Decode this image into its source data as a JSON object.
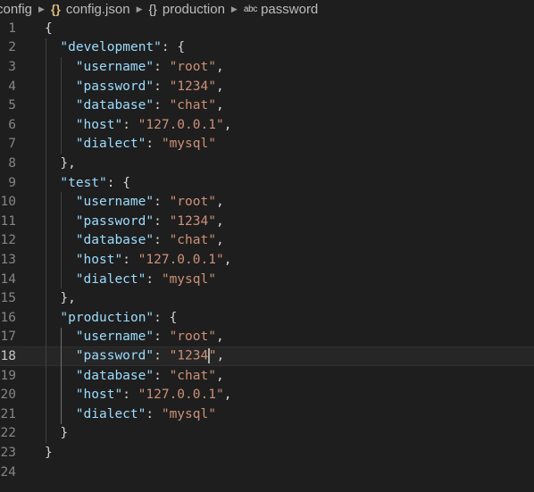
{
  "breadcrumb": {
    "items": [
      {
        "label": "config",
        "icon": ""
      },
      {
        "label": "config.json",
        "icon": "{}"
      },
      {
        "label": "production",
        "icon": "{}"
      },
      {
        "label": "password",
        "icon": "abc"
      }
    ],
    "separator": "▶"
  },
  "editor": {
    "current_line": 18,
    "lines": [
      {
        "n": "1",
        "indent": 0,
        "tokens": [
          {
            "t": "punc",
            "v": "{"
          }
        ]
      },
      {
        "n": "2",
        "indent": 1,
        "tokens": [
          {
            "t": "key",
            "v": "\"development\""
          },
          {
            "t": "punc",
            "v": ": {"
          }
        ]
      },
      {
        "n": "3",
        "indent": 2,
        "tokens": [
          {
            "t": "key",
            "v": "\"username\""
          },
          {
            "t": "punc",
            "v": ": "
          },
          {
            "t": "str",
            "v": "\"root\""
          },
          {
            "t": "punc",
            "v": ","
          }
        ]
      },
      {
        "n": "4",
        "indent": 2,
        "tokens": [
          {
            "t": "key",
            "v": "\"password\""
          },
          {
            "t": "punc",
            "v": ": "
          },
          {
            "t": "str",
            "v": "\"1234\""
          },
          {
            "t": "punc",
            "v": ","
          }
        ]
      },
      {
        "n": "5",
        "indent": 2,
        "tokens": [
          {
            "t": "key",
            "v": "\"database\""
          },
          {
            "t": "punc",
            "v": ": "
          },
          {
            "t": "str",
            "v": "\"chat\""
          },
          {
            "t": "punc",
            "v": ","
          }
        ]
      },
      {
        "n": "6",
        "indent": 2,
        "tokens": [
          {
            "t": "key",
            "v": "\"host\""
          },
          {
            "t": "punc",
            "v": ": "
          },
          {
            "t": "str",
            "v": "\"127.0.0.1\""
          },
          {
            "t": "punc",
            "v": ","
          }
        ]
      },
      {
        "n": "7",
        "indent": 2,
        "tokens": [
          {
            "t": "key",
            "v": "\"dialect\""
          },
          {
            "t": "punc",
            "v": ": "
          },
          {
            "t": "str",
            "v": "\"mysql\""
          }
        ]
      },
      {
        "n": "8",
        "indent": 1,
        "tokens": [
          {
            "t": "punc",
            "v": "},"
          }
        ]
      },
      {
        "n": "9",
        "indent": 1,
        "tokens": [
          {
            "t": "key",
            "v": "\"test\""
          },
          {
            "t": "punc",
            "v": ": {"
          }
        ]
      },
      {
        "n": "10",
        "indent": 2,
        "tokens": [
          {
            "t": "key",
            "v": "\"username\""
          },
          {
            "t": "punc",
            "v": ": "
          },
          {
            "t": "str",
            "v": "\"root\""
          },
          {
            "t": "punc",
            "v": ","
          }
        ]
      },
      {
        "n": "11",
        "indent": 2,
        "tokens": [
          {
            "t": "key",
            "v": "\"password\""
          },
          {
            "t": "punc",
            "v": ": "
          },
          {
            "t": "str",
            "v": "\"1234\""
          },
          {
            "t": "punc",
            "v": ","
          }
        ]
      },
      {
        "n": "12",
        "indent": 2,
        "tokens": [
          {
            "t": "key",
            "v": "\"database\""
          },
          {
            "t": "punc",
            "v": ": "
          },
          {
            "t": "str",
            "v": "\"chat\""
          },
          {
            "t": "punc",
            "v": ","
          }
        ]
      },
      {
        "n": "13",
        "indent": 2,
        "tokens": [
          {
            "t": "key",
            "v": "\"host\""
          },
          {
            "t": "punc",
            "v": ": "
          },
          {
            "t": "str",
            "v": "\"127.0.0.1\""
          },
          {
            "t": "punc",
            "v": ","
          }
        ]
      },
      {
        "n": "14",
        "indent": 2,
        "tokens": [
          {
            "t": "key",
            "v": "\"dialect\""
          },
          {
            "t": "punc",
            "v": ": "
          },
          {
            "t": "str",
            "v": "\"mysql\""
          }
        ]
      },
      {
        "n": "15",
        "indent": 1,
        "tokens": [
          {
            "t": "punc",
            "v": "},"
          }
        ]
      },
      {
        "n": "16",
        "indent": 1,
        "tokens": [
          {
            "t": "key",
            "v": "\"production\""
          },
          {
            "t": "punc",
            "v": ": {"
          }
        ]
      },
      {
        "n": "17",
        "indent": 2,
        "tokens": [
          {
            "t": "key",
            "v": "\"username\""
          },
          {
            "t": "punc",
            "v": ": "
          },
          {
            "t": "str",
            "v": "\"root\""
          },
          {
            "t": "punc",
            "v": ","
          }
        ]
      },
      {
        "n": "18",
        "indent": 2,
        "tokens": [
          {
            "t": "key",
            "v": "\"password\""
          },
          {
            "t": "punc",
            "v": ": "
          },
          {
            "t": "str",
            "v": "\"1234"
          },
          {
            "t": "cursor",
            "v": ""
          },
          {
            "t": "str",
            "v": "\""
          },
          {
            "t": "punc",
            "v": ","
          }
        ]
      },
      {
        "n": "19",
        "indent": 2,
        "tokens": [
          {
            "t": "key",
            "v": "\"database\""
          },
          {
            "t": "punc",
            "v": ": "
          },
          {
            "t": "str",
            "v": "\"chat\""
          },
          {
            "t": "punc",
            "v": ","
          }
        ]
      },
      {
        "n": "20",
        "indent": 2,
        "tokens": [
          {
            "t": "key",
            "v": "\"host\""
          },
          {
            "t": "punc",
            "v": ": "
          },
          {
            "t": "str",
            "v": "\"127.0.0.1\""
          },
          {
            "t": "punc",
            "v": ","
          }
        ]
      },
      {
        "n": "21",
        "indent": 2,
        "tokens": [
          {
            "t": "key",
            "v": "\"dialect\""
          },
          {
            "t": "punc",
            "v": ": "
          },
          {
            "t": "str",
            "v": "\"mysql\""
          }
        ]
      },
      {
        "n": "22",
        "indent": 1,
        "tokens": [
          {
            "t": "punc",
            "v": "}"
          }
        ]
      },
      {
        "n": "23",
        "indent": 0,
        "tokens": [
          {
            "t": "punc",
            "v": "}"
          }
        ]
      },
      {
        "n": "24",
        "indent": 0,
        "tokens": []
      }
    ]
  },
  "colors": {
    "background": "#1e1e1e",
    "key": "#9cdcfe",
    "string": "#ce9178",
    "punctuation": "#d4d4d4",
    "line_number": "#858585"
  }
}
